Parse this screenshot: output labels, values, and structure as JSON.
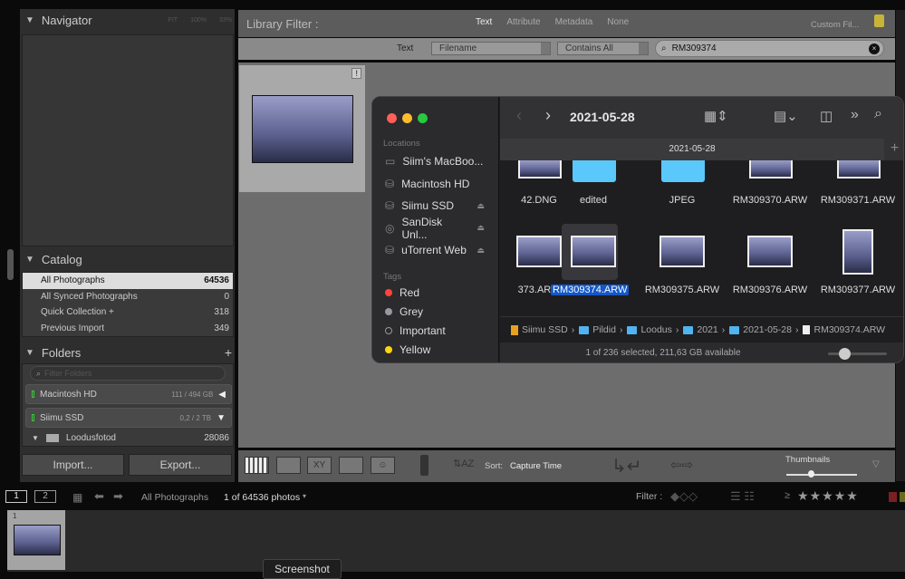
{
  "navigator": {
    "title": "Navigator",
    "zoom_options": [
      "FIT",
      "100%",
      "33%"
    ]
  },
  "catalog": {
    "title": "Catalog",
    "items": [
      {
        "label": "All Photographs",
        "count": "64536"
      },
      {
        "label": "All Synced Photographs",
        "count": "0"
      },
      {
        "label": "Quick Collection +",
        "count": "318"
      },
      {
        "label": "Previous Import",
        "count": "349"
      }
    ]
  },
  "folders": {
    "title": "Folders",
    "add": "+",
    "filter_placeholder": "Filter Folders",
    "drives": [
      {
        "name": "Macintosh HD",
        "usage": "111 / 494 GB"
      },
      {
        "name": "Siimu SSD",
        "usage": "0,2 / 2 TB"
      }
    ],
    "subfolder": {
      "name": "Loodusfotod",
      "count": "28086"
    }
  },
  "buttons": {
    "import": "Import...",
    "export": "Export..."
  },
  "library_filter": {
    "title": "Library Filter :",
    "tabs": [
      "Text",
      "Attribute",
      "Metadata",
      "None"
    ],
    "preset": "Custom Fil...",
    "text_label": "Text",
    "field": "Filename",
    "rule": "Contains All",
    "search": "RM309374"
  },
  "grid": {
    "badge": "!"
  },
  "toolbar": {
    "sort_label": "Sort:",
    "sort_value": "Capture Time",
    "thumbnails_label": "Thumbnails",
    "thumbnail_size": 0.35
  },
  "filmstrip": {
    "screen1": "1",
    "screen2": "2",
    "source": "All Photographs",
    "count": "1 of 64536 photos",
    "filter_label": "Filter :",
    "rating_prefix": "≥",
    "stars": "★★★★★",
    "cell_number": "1"
  },
  "tooltip": "Screenshot",
  "finder": {
    "title": "2021-05-28",
    "tab": "2021-05-28",
    "locations_label": "Locations",
    "locations": [
      {
        "name": "Siim's MacBoo...",
        "eject": false
      },
      {
        "name": "Macintosh HD",
        "eject": false
      },
      {
        "name": "Siimu SSD",
        "eject": true
      },
      {
        "name": "SanDisk Unl...",
        "eject": true
      },
      {
        "name": "uTorrent Web",
        "eject": true
      }
    ],
    "tags_label": "Tags",
    "tags": [
      {
        "name": "Red",
        "color": "#ff453a"
      },
      {
        "name": "Grey",
        "color": "#98989d"
      },
      {
        "name": "Important",
        "color": "none"
      },
      {
        "name": "Yellow",
        "color": "#ffd60a"
      }
    ],
    "files_row1": [
      "42.DNG",
      "edited",
      "JPEG",
      "RM309370.ARW",
      "RM309371.ARW"
    ],
    "files_row2": [
      "373.ARW",
      "RM309374.ARW",
      "RM309375.ARW",
      "RM309376.ARW",
      "RM309377.ARW"
    ],
    "path": [
      "Siimu SSD",
      "Pildid",
      "Loodus",
      "2021",
      "2021-05-28",
      "RM309374.ARW"
    ],
    "status": "1 of 236 selected, 211,63 GB available"
  }
}
